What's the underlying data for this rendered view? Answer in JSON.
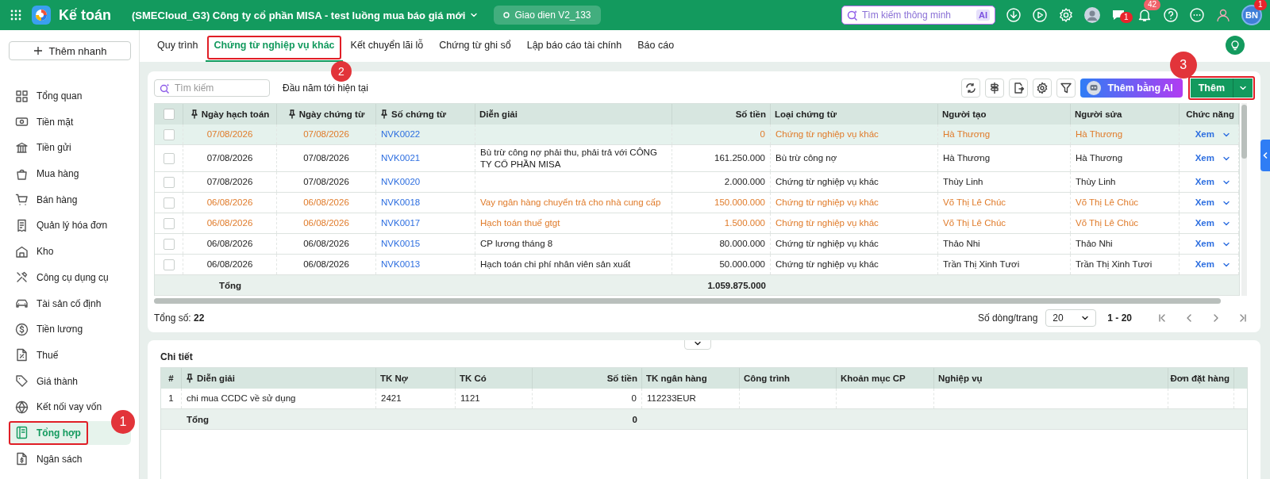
{
  "topbar": {
    "app_title": "Kế toán",
    "company": "(SMECloud_G3) Công ty cổ phần MISA - test luồng mua báo giá mới",
    "version": "Giao dien V2_133",
    "search": {
      "placeholder": "Tìm kiếm thông minh",
      "badge": "AI"
    },
    "chat_badge": "1",
    "notification_badge": "42",
    "avatar_initials": "BN",
    "avatar_badge": "1"
  },
  "sidebar": {
    "quick_add": "Thêm nhanh",
    "items": [
      {
        "label": "Tổng quan",
        "selected": false
      },
      {
        "label": "Tiền mặt",
        "selected": false
      },
      {
        "label": "Tiền gửi",
        "selected": false
      },
      {
        "label": "Mua hàng",
        "selected": false
      },
      {
        "label": "Bán hàng",
        "selected": false
      },
      {
        "label": "Quản lý hóa đơn",
        "selected": false
      },
      {
        "label": "Kho",
        "selected": false
      },
      {
        "label": "Công cụ dụng cụ",
        "selected": false
      },
      {
        "label": "Tài sản cố định",
        "selected": false
      },
      {
        "label": "Tiền lương",
        "selected": false
      },
      {
        "label": "Thuế",
        "selected": false
      },
      {
        "label": "Giá thành",
        "selected": false
      },
      {
        "label": "Kết nối vay vốn",
        "selected": false
      },
      {
        "label": "Tổng hợp",
        "selected": true,
        "callout": "1"
      },
      {
        "label": "Ngân sách",
        "selected": false
      }
    ]
  },
  "tabs": [
    {
      "label": "Quy trình",
      "selected": false
    },
    {
      "label": "Chứng từ nghiệp vụ khác",
      "selected": true,
      "callout": "2"
    },
    {
      "label": "Kết chuyển lãi lỗ",
      "selected": false
    },
    {
      "label": "Chứng từ ghi sổ",
      "selected": false
    },
    {
      "label": "Lập báo cáo tài chính",
      "selected": false
    },
    {
      "label": "Báo cáo",
      "selected": false
    }
  ],
  "toolbar": {
    "search": {
      "placeholder": "Tìm kiếm"
    },
    "period": "Đầu năm tới hiện tại",
    "ai_button": "Thêm bằng AI",
    "add_button": {
      "label": "Thêm",
      "callout": "3"
    }
  },
  "table": {
    "select_all_checked": false,
    "columns": [
      {
        "label": "Ngày hạch toán",
        "pinned": true
      },
      {
        "label": "Ngày chứng từ",
        "pinned": true
      },
      {
        "label": "Số chứng từ",
        "pinned": true
      },
      {
        "label": "Diễn giải",
        "pinned": false
      },
      {
        "label": "Số tiền",
        "pinned": false
      },
      {
        "label": "Loại chứng từ",
        "pinned": false
      },
      {
        "label": "Người tạo",
        "pinned": false
      },
      {
        "label": "Người sửa",
        "pinned": false
      },
      {
        "label": "Chức năng",
        "pinned": false
      }
    ],
    "rows": [
      {
        "selected": true,
        "flagged": true,
        "checked": false,
        "posting_date": "07/08/2026",
        "doc_date": "07/08/2026",
        "doc_no": "NVK0022",
        "amount": "0",
        "doc_type": "Chứng từ nghiệp vụ khác",
        "created_by": "Hà Thương",
        "modified_by": "Hà Thương",
        "action": "Xem"
      },
      {
        "selected": false,
        "flagged": false,
        "checked": false,
        "posting_date": "07/08/2026",
        "doc_date": "07/08/2026",
        "doc_no": "NVK0021",
        "description": "Bù trừ công nợ phải thu, phải trả với CÔNG TY CỔ PHẦN MISA",
        "amount": "161.250.000",
        "doc_type": "Bù trừ công nợ",
        "created_by": "Hà Thương",
        "modified_by": "Hà Thương",
        "action": "Xem"
      },
      {
        "selected": false,
        "flagged": false,
        "checked": false,
        "posting_date": "07/08/2026",
        "doc_date": "07/08/2026",
        "doc_no": "NVK0020",
        "amount": "2.000.000",
        "doc_type": "Chứng từ nghiệp vụ khác",
        "created_by": "Thùy Linh",
        "modified_by": "Thùy Linh",
        "action": "Xem"
      },
      {
        "selected": false,
        "flagged": true,
        "checked": false,
        "posting_date": "06/08/2026",
        "doc_date": "06/08/2026",
        "doc_no": "NVK0018",
        "description": "Vay ngân hàng chuyển trả cho nhà cung cấp",
        "amount": "150.000.000",
        "doc_type": "Chứng từ nghiệp vụ khác",
        "created_by": "Võ Thị Lê Chúc",
        "modified_by": "Võ Thị Lê Chúc",
        "action": "Xem"
      },
      {
        "selected": false,
        "flagged": true,
        "checked": false,
        "posting_date": "06/08/2026",
        "doc_date": "06/08/2026",
        "doc_no": "NVK0017",
        "description": "Hạch toán thuế gtgt",
        "amount": "1.500.000",
        "doc_type": "Chứng từ nghiệp vụ khác",
        "created_by": "Võ Thị Lê Chúc",
        "modified_by": "Võ Thị Lê Chúc",
        "action": "Xem"
      },
      {
        "selected": false,
        "flagged": false,
        "checked": false,
        "posting_date": "06/08/2026",
        "doc_date": "06/08/2026",
        "doc_no": "NVK0015",
        "description": "CP lương tháng 8",
        "amount": "80.000.000",
        "doc_type": "Chứng từ nghiệp vụ khác",
        "created_by": "Thảo Nhi",
        "modified_by": "Thảo Nhi",
        "action": "Xem"
      },
      {
        "selected": false,
        "flagged": false,
        "checked": false,
        "posting_date": "06/08/2026",
        "doc_date": "06/08/2026",
        "doc_no": "NVK0013",
        "description": "Hạch toán chi phí nhân viên sản xuất",
        "amount": "50.000.000",
        "doc_type": "Chứng từ nghiệp vụ khác",
        "created_by": "Trần Thị Xinh Tươi",
        "modified_by": "Trần Thị Xinh Tươi",
        "action": "Xem"
      }
    ],
    "total_label": "Tổng",
    "total_amount": "1.059.875.000"
  },
  "pager": {
    "total": "Tổng số: **22**",
    "rows_per_page_label": "Số dòng/trang",
    "rows_per_page": "20",
    "range": "1 - 20"
  },
  "detail": {
    "title": "Chi tiết",
    "expanded": true,
    "columns": [
      {
        "label": "#",
        "pinned": false
      },
      {
        "label": "Diễn giải",
        "pinned": true
      },
      {
        "label": "TK Nợ",
        "pinned": false
      },
      {
        "label": "TK Có",
        "pinned": false
      },
      {
        "label": "Số tiền",
        "pinned": false
      },
      {
        "label": "TK ngân hàng",
        "pinned": false
      },
      {
        "label": "Công trình",
        "pinned": false
      },
      {
        "label": "Khoản mục CP",
        "pinned": false
      },
      {
        "label": "Nghiệp vụ",
        "pinned": false
      },
      {
        "label": "Đơn đặt hàng",
        "pinned": false
      }
    ],
    "rows": [
      {
        "no": "1",
        "description": "chi mua CCDC về sử dụng",
        "debit": "2421",
        "credit": "1121",
        "amount": "0",
        "bank_account": "112233EUR"
      }
    ],
    "total_label": "Tổng",
    "total_amount": "0"
  }
}
